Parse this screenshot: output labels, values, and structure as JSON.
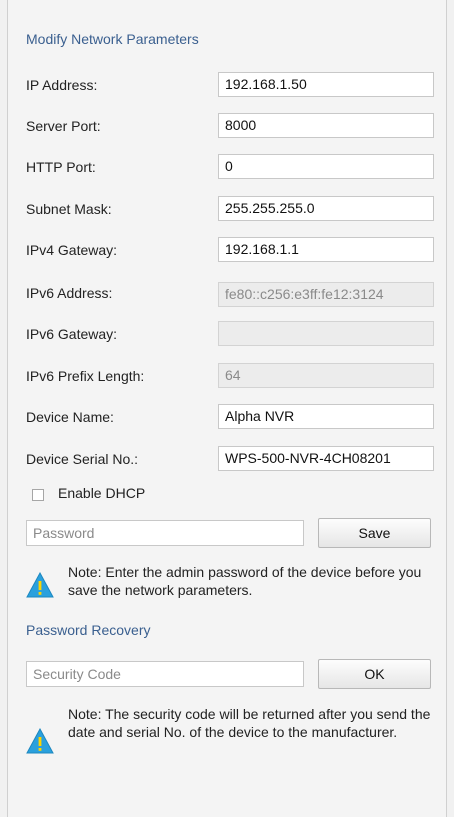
{
  "sections": {
    "network_title": "Modify Network Parameters",
    "recovery_title": "Password Recovery"
  },
  "fields": {
    "ip_address": {
      "label": "IP Address:",
      "value": "192.168.1.50"
    },
    "server_port": {
      "label": "Server Port:",
      "value": "8000"
    },
    "http_port": {
      "label": "HTTP Port:",
      "value": "0"
    },
    "subnet_mask": {
      "label": "Subnet Mask:",
      "value": "255.255.255.0"
    },
    "ipv4_gateway": {
      "label": "IPv4 Gateway:",
      "value": "192.168.1.1"
    },
    "ipv6_address": {
      "label": "IPv6 Address:",
      "value": "fe80::c256:e3ff:fe12:3124"
    },
    "ipv6_gateway": {
      "label": "IPv6 Gateway:",
      "value": ""
    },
    "ipv6_prefix_length": {
      "label": "IPv6 Prefix Length:",
      "value": "64"
    },
    "device_name": {
      "label": "Device Name:",
      "value": "Alpha NVR"
    },
    "device_serial": {
      "label": "Device Serial No.:",
      "value": "WPS-500-NVR-4CH08201"
    }
  },
  "dhcp": {
    "label": "Enable DHCP",
    "checked": false
  },
  "password": {
    "placeholder": "Password"
  },
  "save_button": "Save",
  "note_save": "Note: Enter the admin password of the device before you save the network parameters.",
  "security_code": {
    "placeholder": "Security Code"
  },
  "ok_button": "OK",
  "note_recovery": "Note: The security code will be returned after you send the date and serial No. of the device to the manufacturer.",
  "icons": {
    "warning": "warning-icon"
  },
  "colors": {
    "section_title": "#3a5f8f",
    "warning": "#2aa0dd",
    "warning_mark": "#ffd400"
  }
}
